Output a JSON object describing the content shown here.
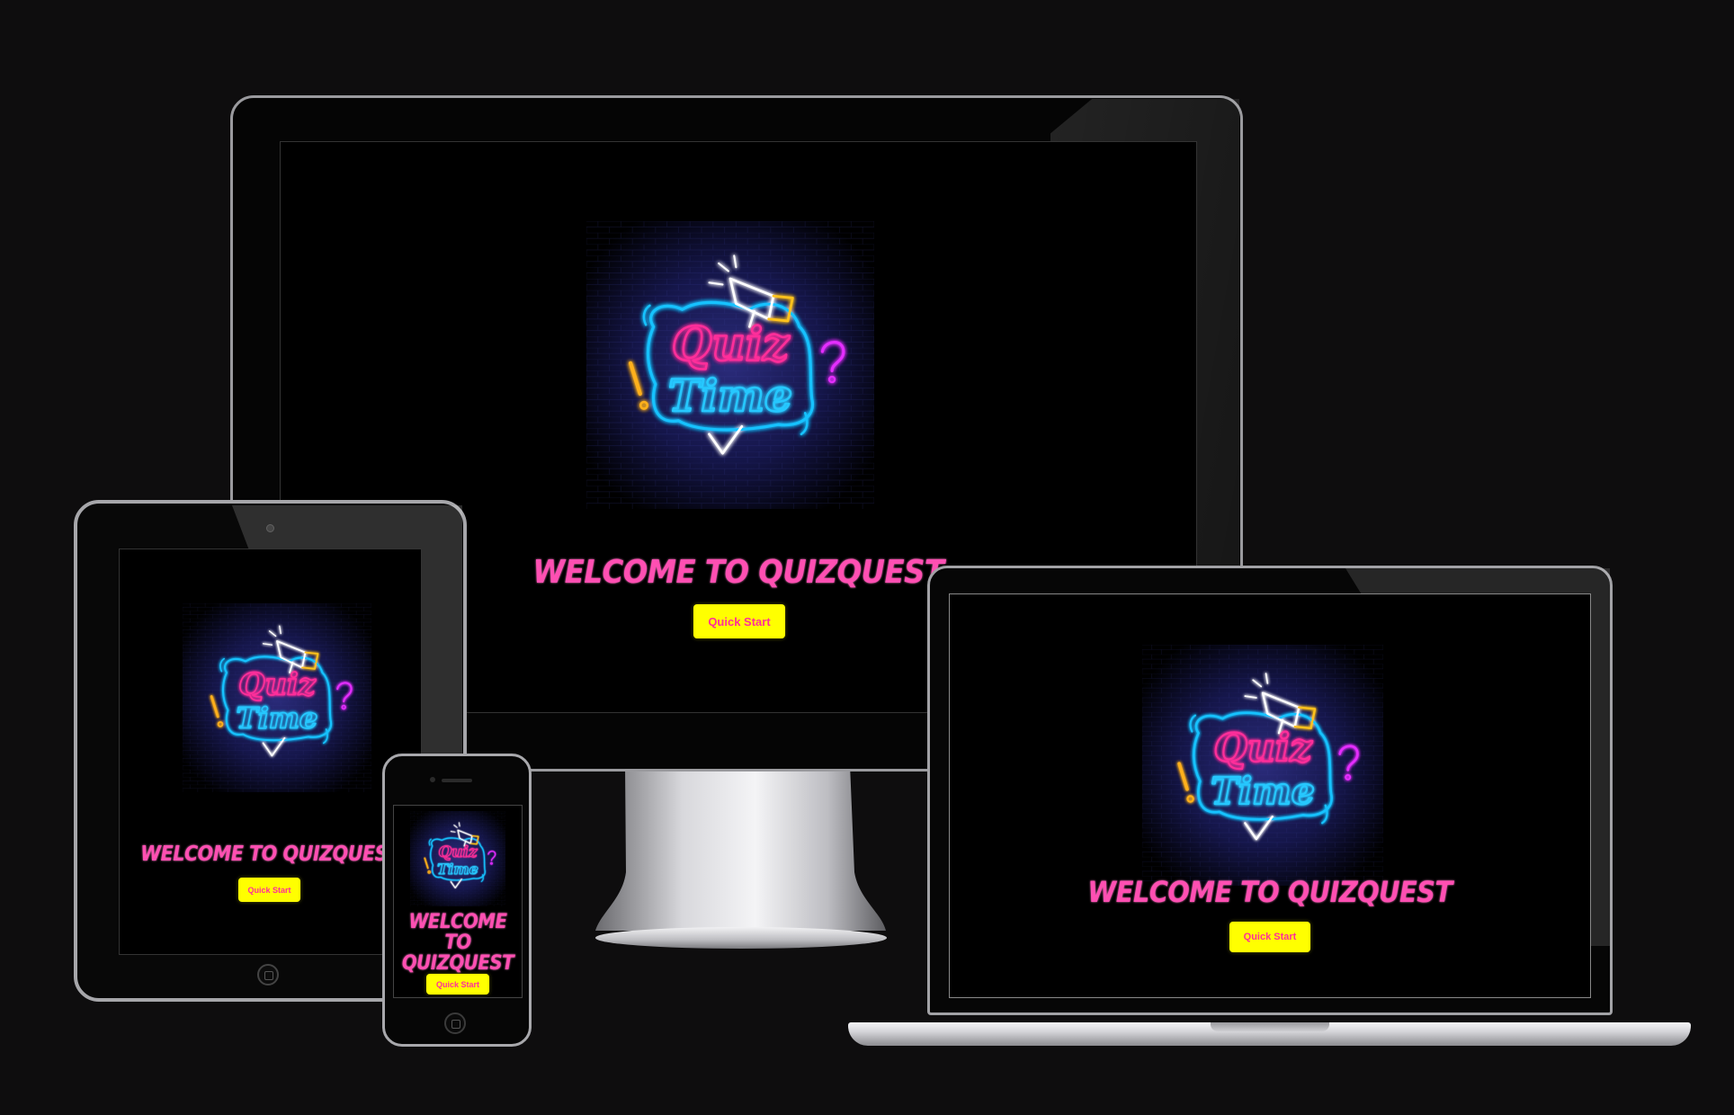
{
  "showcase": {
    "welcome_text": "WELCOME TO QUIZQUEST",
    "quick_start_label": "Quick Start",
    "logo_line1": "Quiz",
    "logo_line2": "Time"
  },
  "colors": {
    "page_background": "#0e0d0e",
    "welcome_pink": "#ff4fb2",
    "button_yellow": "#ffff00",
    "button_text_pink": "#ff2e9a"
  },
  "icons": [
    "megaphone-icon",
    "exclamation-icon",
    "question-mark-icon",
    "checkmark-icon",
    "home-button-icon"
  ]
}
